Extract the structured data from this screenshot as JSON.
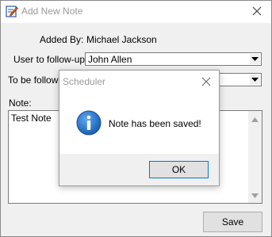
{
  "window": {
    "title": "Add New Note"
  },
  "form": {
    "added_by_label": "Added By:",
    "added_by_value": "Michael Jackson",
    "user_follow_label": "User to follow-up:",
    "user_follow_value": "John Allen",
    "to_be_follow_label": "To be follow-u",
    "to_be_follow_value": "",
    "note_label": "Note:",
    "note_value": "Test Note",
    "save_label": "Save"
  },
  "dialog": {
    "title": "Scheduler",
    "message": "Note has been saved!",
    "ok_label": "OK"
  },
  "colors": {
    "accent": "#0078d7",
    "info_icon": "#1a5fb4"
  }
}
